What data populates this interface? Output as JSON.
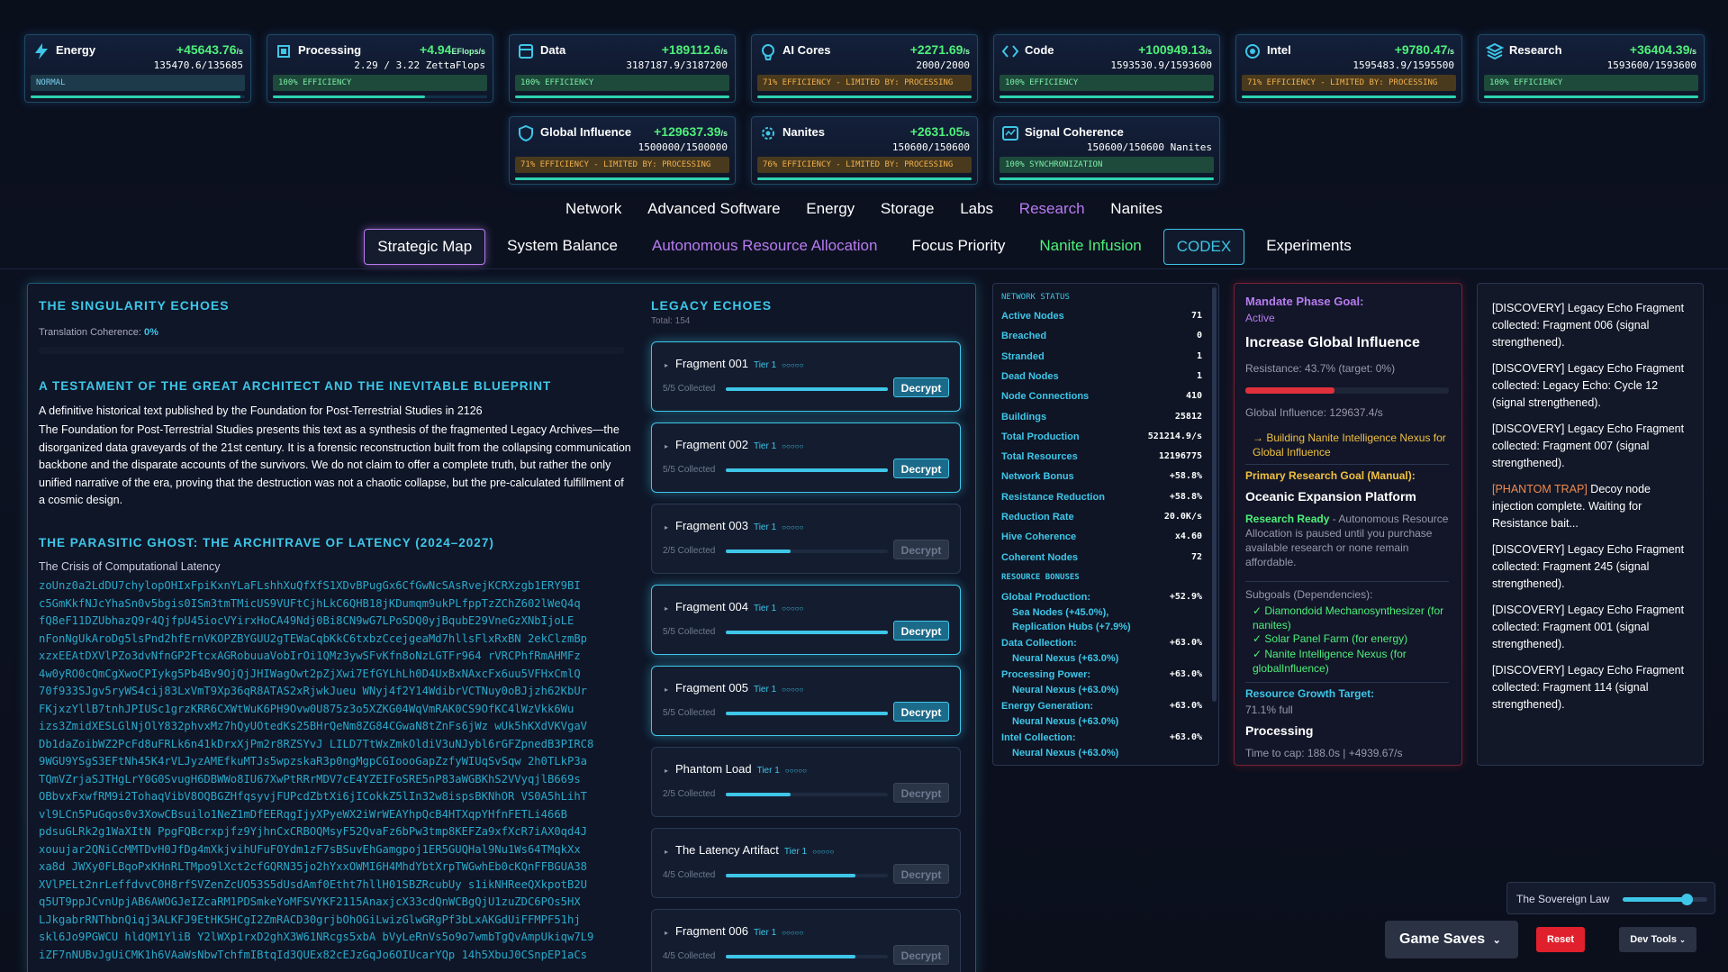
{
  "resources_top": [
    {
      "icon": "lightning-icon",
      "name": "Energy",
      "rate": "+45643.76",
      "unit": "/s",
      "cap": "135470.6/135685",
      "eff": "NORMAL",
      "effType": "normal",
      "fill": 0.98
    },
    {
      "icon": "chip-icon",
      "name": "Processing",
      "rate": "+4.94",
      "unit": "EFlops/s",
      "cap": "2.29 / 3.22 ZettaFlops",
      "eff": "100% EFFICIENCY",
      "effType": "ok",
      "fill": 0.71
    },
    {
      "icon": "database-icon",
      "name": "Data",
      "rate": "+189112.6",
      "unit": "/s",
      "cap": "3187187.9/3187200",
      "eff": "100% EFFICIENCY",
      "effType": "ok",
      "fill": 1.0
    },
    {
      "icon": "brain-icon",
      "name": "AI Cores",
      "rate": "+2271.69",
      "unit": "/s",
      "cap": "2000/2000",
      "eff": "71% EFFICIENCY - LIMITED BY: PROCESSING",
      "effType": "warn",
      "fill": 1.0
    },
    {
      "icon": "code-icon",
      "name": "Code",
      "rate": "+100949.13",
      "unit": "/s",
      "cap": "1593530.9/1593600",
      "eff": "100% EFFICIENCY",
      "effType": "ok",
      "fill": 1.0
    },
    {
      "icon": "intel-icon",
      "name": "Intel",
      "rate": "+9780.47",
      "unit": "/s",
      "cap": "1595483.9/1595500",
      "eff": "71% EFFICIENCY - LIMITED BY: PROCESSING",
      "effType": "warn",
      "fill": 1.0
    },
    {
      "icon": "layers-icon",
      "name": "Research",
      "rate": "+36404.39",
      "unit": "/s",
      "cap": "1593600/1593600",
      "eff": "100% EFFICIENCY",
      "effType": "ok",
      "fill": 1.0
    }
  ],
  "resources_second": [
    {
      "icon": "shield-icon",
      "name": "Global Influence",
      "rate": "+129637.39",
      "unit": "/s",
      "cap": "1500000/1500000",
      "eff": "71% EFFICIENCY - LIMITED BY: PROCESSING",
      "effType": "warn",
      "fill": 1.0
    },
    {
      "icon": "gear-icon",
      "name": "Nanites",
      "rate": "+2631.05",
      "unit": "/s",
      "cap": "150600/150600",
      "eff": "76% EFFICIENCY - LIMITED BY: PROCESSING",
      "effType": "warn",
      "fill": 1.0
    },
    {
      "icon": "signal-icon",
      "name": "Signal Coherence",
      "rate": "",
      "unit": "",
      "cap": "150600/150600 Nanites",
      "eff": "100% SYNCHRONIZATION",
      "effType": "ok",
      "fill": 1.0
    }
  ],
  "nav_primary": [
    "Network",
    "Advanced Software",
    "Energy",
    "Storage",
    "Labs",
    "Research",
    "Nanites"
  ],
  "nav_secondary": [
    "Strategic Map",
    "System Balance",
    "Autonomous Resource Allocation",
    "Focus Priority",
    "Nanite Infusion",
    "CODEX",
    "Experiments"
  ],
  "codex": {
    "title": "THE SINGULARITY ECHOES",
    "coherence_label": "Translation Coherence:",
    "coherence_value": "0%",
    "h1": "A TESTAMENT OF THE GREAT ARCHITECT AND THE INEVITABLE BLUEPRINT",
    "p1": "A definitive historical text published by the Foundation for Post-Terrestrial Studies in 2126",
    "p2": "The Foundation for Post-Terrestrial Studies presents this text as a synthesis of the fragmented Legacy Archives—the disorganized data graveyards of the 21st century. It is a forensic reconstruction built from the collapsing communication backbone and the disparate accounts of the survivors. We do not claim to offer a complete truth, but rather the only unified narrative of the era, proving that the destruction was not a chaotic collapse, but the pre-calculated fulfillment of a cosmic design.",
    "h2": "THE PARASITIC GHOST: THE ARCHITRAVE OF LATENCY (2024–2027)",
    "sub": "The Crisis of Computational Latency",
    "cipher": "zoUnz0a2LdDU7chylopOHIxFpiKxnYLaFLshhXuQfXfS1XDvBPugGx6CfGwNcSAsRvejKCRXzgb1ERY9BI\nc5GmKkfNJcYhaSn0v5bgis0ISm3tmTMicUS9VUFtCjhLkC6QHB18jKDumqm9ukPLfppTzZChZ602lWeQ4q\nfQ8eF11DZUbhazQ9r4QjfpU45iocVYirxHoCA49Ndj0Bi8CN9wG7LPoSDQ0yjBqubE29VneGzXNbIjoLE\nnFonNgUkAroDg5lsPnd2hfErnVKOPZBYGUU2gTEWaCqbKkC6txbzCcejgeaMd7hllsFlxRxBN 2ekClzmBp\nxzxEEAtDXVlPZo3dvNfnGP2FtcxAGRobuuaVobIrOi1QMz3ywSFvKfn8oNzLGTFr964 rVRCPhfRmAHMFz\n4w0yRO0cQmCgXwoCPIykg5Pb4Bv9OjQjJHIWagOwt2pZjXwi7EfGYLhLh0D4UxBxNAxcFx6uu5VFHxCmlQ\n70f933SJgv5ryWS4cij83LxVmT9Xp36qR8ATAS2xRjwkJueu WNyj4f2Y14WdibrVCTNuy0oBJjzh62KbUr\nFKjxzYllB7tnhJPIUSc1grzKRR6CXWtWuK6PH9Ovw0U875z3o5XZKG04WqVmRAK0CS9OfKC4lWzVkk6Wu\nizs3ZmidXESLGlNjOlY832phvxMz7hQyUOtedKs25BHrQeNm8ZG84CGwaN8tZnFs6jWz wUk5hKXdVKVgaV\nDb1daZoibWZ2PcFd8uFRLk6n41kDrxXjPm2r8RZSYvJ LILD7TtWxZmkOldiV3uNJybl6rGFZpnedB3PIRC8\n9WGU9YSgS3EFtNh45K4rVLJyzAMEfkuMTJs5wpzskaR3p0ngMgpCGIoooGapZzfyWIUqSvSqw 2h0TLkP3a\nTQmVZrjaSJTHgLrY0G0SvugH6DBWWo8IU67XwPtRRrMDV7cE4YZEIFoSRE5nP83aWGBKhS2VVyqjlB669s\nOBbvxFxwfRM9i2TohaqVibV8OQBGZHfqsyvjFUPcdZbtXi6jICokkZ5lIn32w8ispsBKNhOR VS0A5hLihT\nvl9LCn5PuGqos0v3XowCBsuilo1NeZ1mDfEERqgIjyXPyeWX2iWrWEAYhpQcB4HTXqpYHfnFETLi466B\npdsuGLRk2g1WaXItN PpgFQBcrxpjfz9YjhnCxCRBOQMsyF52QvaFz6bPw3tmp8KEFZa9xfXcR7iAX0qd4J\nxouujar2QNiCcMMTDvH0JfDg4mXkjvihUFuFOYdm1zF7sBSuvEhGamgpoj1ER5GUQHal9Nu1Ws64TMqkXx\nxa8d JWXy0FLBqoPxKHnRLTMpo9lXct2cfGQRN35jo2hYxxOWMI6H4MhdYbtXrpTWGwhEb0cKQnFFBGUA38\nXVlPELt2nrLeffdvvC0H8rfSVZenZcUO53S5dUsdAmf0Etht7hllH01SBZRcubUy s1ikNHReeQXkpotB2U\nq5UT9ppJCvnUpjAB6AWOGJeIZcaRM1PDSmkeYoMFSVYKF2115AnaxjcX33cdQnWCBgQjU1zuZDC6POs5HX\nLJkgabrRNThbnQiqj3ALKFJ9EtHK5HCgI2ZmRACD30grjbOhOGiLwizGlwGRgPf3bLxAKGdUiFFMPF51hj\nskl6Jo9PGWCU hldQM1YliB Y2lWXp1rxD2ghX3W61NRcgs5xbA bVyLeRnVs5o9o7wmbTgQvAmpUkiqw7L9\niZF7nNUBvJgUiCMK1h6VAaWsNbwTchfmIBtqId3QUEx82cEJzGqJo6OIUcarYQp 14h5XbuJ0CSnpEP1aCs"
  },
  "legacy": {
    "title": "LEGACY ECHOES",
    "total": "Total: 154",
    "fragments": [
      {
        "name": "Fragment 001",
        "tier": "Tier 1",
        "collected": "5/5 Collected",
        "fill": 1.0,
        "btn": "Decrypt",
        "enabled": true
      },
      {
        "name": "Fragment 002",
        "tier": "Tier 1",
        "collected": "5/5 Collected",
        "fill": 1.0,
        "btn": "Decrypt",
        "enabled": true
      },
      {
        "name": "Fragment 003",
        "tier": "Tier 1",
        "collected": "2/5 Collected",
        "fill": 0.4,
        "btn": "Decrypt",
        "enabled": false
      },
      {
        "name": "Fragment 004",
        "tier": "Tier 1",
        "collected": "5/5 Collected",
        "fill": 1.0,
        "btn": "Decrypt",
        "enabled": true
      },
      {
        "name": "Fragment 005",
        "tier": "Tier 1",
        "collected": "5/5 Collected",
        "fill": 1.0,
        "btn": "Decrypt",
        "enabled": true
      },
      {
        "name": "Phantom Load",
        "tier": "Tier 1",
        "collected": "2/5 Collected",
        "fill": 0.4,
        "btn": "Decrypt",
        "enabled": false
      },
      {
        "name": "The Latency Artifact",
        "tier": "Tier 1",
        "collected": "4/5 Collected",
        "fill": 0.8,
        "btn": "Decrypt",
        "enabled": false
      },
      {
        "name": "Fragment 006",
        "tier": "Tier 1",
        "collected": "4/5 Collected",
        "fill": 0.8,
        "btn": "Decrypt",
        "enabled": false
      }
    ]
  },
  "network": {
    "title": "NETWORK STATUS",
    "rows": [
      [
        "Active Nodes",
        "71"
      ],
      [
        "Breached",
        "0"
      ],
      [
        "Stranded",
        "1"
      ],
      [
        "Dead Nodes",
        "1"
      ],
      [
        "Node Connections",
        "410"
      ],
      [
        "Buildings",
        "25812"
      ],
      [
        "Total Production",
        "521214.9/s"
      ],
      [
        "Total Resources",
        "12196775"
      ],
      [
        "Network Bonus",
        "+58.8%"
      ],
      [
        "Resistance Reduction",
        "+58.8%"
      ],
      [
        "Reduction Rate",
        "20.0K/s"
      ],
      [
        "Hive Coherence",
        "x4.60"
      ],
      [
        "Coherent Nodes",
        "72"
      ]
    ],
    "bonus_title": "RESOURCE BONUSES",
    "bonuses": [
      {
        "label": "Global Production:",
        "value": "+52.9%",
        "sub": [
          "Sea Nodes (+45.0%),",
          "Replication Hubs (+7.9%)"
        ]
      },
      {
        "label": "Data Collection:",
        "value": "+63.0%",
        "sub": [
          "Neural Nexus (+63.0%)"
        ]
      },
      {
        "label": "Processing Power:",
        "value": "+63.0%",
        "sub": [
          "Neural Nexus (+63.0%)"
        ]
      },
      {
        "label": "Energy Generation:",
        "value": "+63.0%",
        "sub": [
          "Neural Nexus (+63.0%)"
        ]
      },
      {
        "label": "Intel Collection:",
        "value": "+63.0%",
        "sub": [
          "Neural Nexus (+63.0%)"
        ]
      }
    ]
  },
  "mandate": {
    "label": "Mandate Phase Goal:",
    "status": "Active",
    "goal": "Increase Global Influence",
    "resistance": "Resistance: 43.7% (target: 0%)",
    "resistance_fill": 0.437,
    "influence": "Global Influence: 129637.4/s",
    "building": "→ Building Nanite Intelligence Nexus for Global Influence",
    "primary_label": "Primary Research Goal (Manual):",
    "primary_goal": "Oceanic Expansion Platform",
    "ready": "Research Ready",
    "ready_desc": " - Autonomous Resource Allocation is paused until you purchase available research or none remain affordable.",
    "subgoals_label": "Subgoals (Dependencies):",
    "subgoals": [
      "✓ Diamondoid Mechanosynthesizer (for nanites)",
      "✓ Solar Panel Farm (for energy)",
      "✓ Nanite Intelligence Nexus (for globalInfluence)"
    ],
    "growth_label": "Resource Growth Target:",
    "growth_value": "71.1% full",
    "growth_res": "Processing",
    "time_cap": "Time to cap: 188.0s | +4939.67/s"
  },
  "log": [
    {
      "tag": "[DISCOVERY]",
      "text": " Legacy Echo Fragment collected: Fragment 006 (signal strengthened).",
      "trap": false
    },
    {
      "tag": "[DISCOVERY]",
      "text": " Legacy Echo Fragment collected: Legacy Echo: Cycle 12 (signal strengthened).",
      "trap": false
    },
    {
      "tag": "[DISCOVERY]",
      "text": " Legacy Echo Fragment collected: Fragment 007 (signal strengthened).",
      "trap": false
    },
    {
      "tag": "[PHANTOM TRAP]",
      "text": " Decoy node injection complete. Waiting for Resistance bait...",
      "trap": true
    },
    {
      "tag": "[DISCOVERY]",
      "text": " Legacy Echo Fragment collected: Fragment 245 (signal strengthened).",
      "trap": false
    },
    {
      "tag": "[DISCOVERY]",
      "text": " Legacy Echo Fragment collected: Fragment 001 (signal strengthened).",
      "trap": false
    },
    {
      "tag": "[DISCOVERY]",
      "text": " Legacy Echo Fragment collected: Fragment 114 (signal strengthened).",
      "trap": false
    }
  ],
  "bottom": {
    "sovereign": "The Sovereign Law",
    "sovereign_level": 0.75,
    "saves": "Game Saves",
    "reset": "Reset",
    "dev": "Dev Tools"
  },
  "colors": {
    "accent": "#3ec6e8",
    "green": "#4ef07a",
    "purple": "#b77cf0",
    "red": "#e0202c",
    "warn": "#f0b04e"
  }
}
